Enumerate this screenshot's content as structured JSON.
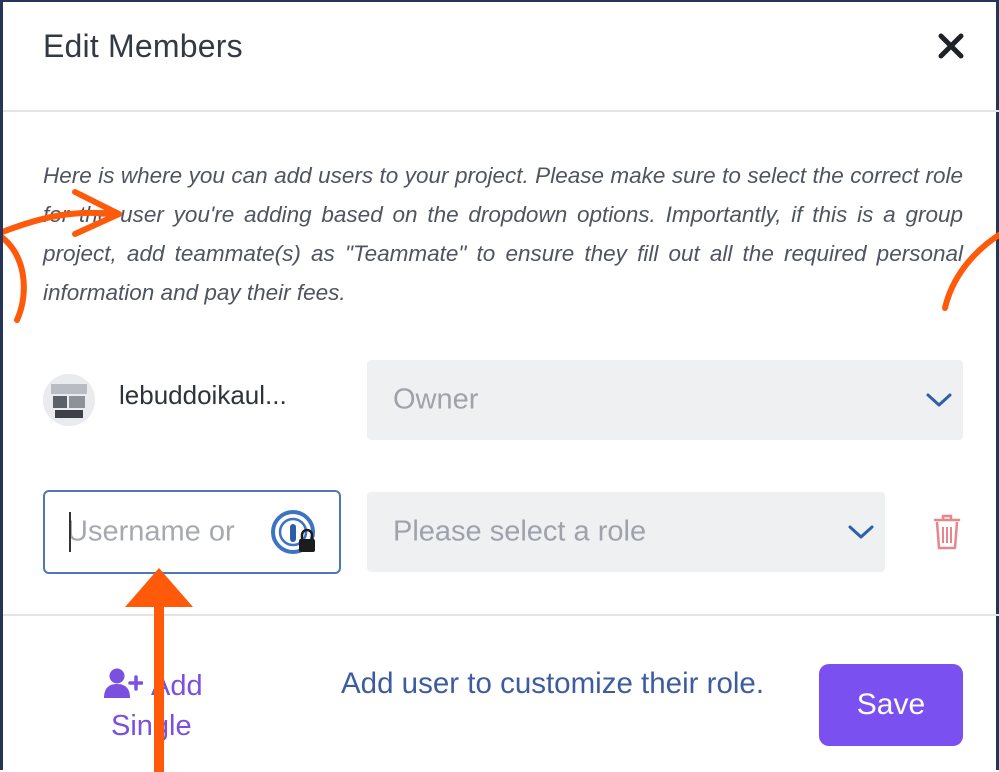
{
  "modal": {
    "title": "Edit Members",
    "intro_text": "Here is where you can add users to your project. Please make sure to select the correct role for the user you're adding based on the dropdown options. Importantly, if this is a group project, add teammate(s) as \"Teammate\" to ensure they fill out all the required personal information and pay their fees."
  },
  "members": {
    "existing": {
      "username": "lebuddoikaul...",
      "role": "Owner"
    },
    "new": {
      "username_placeholder": "Username or",
      "role_placeholder": "Please select a role"
    }
  },
  "footer": {
    "add_single_line1": "Add",
    "add_single_line2": "Single",
    "hint": "Add user to customize their role.",
    "save_label": "Save"
  },
  "icons": {
    "close": "close-icon",
    "chevron": "chevron-down-icon",
    "trash": "trash-icon",
    "user_plus": "user-plus-icon",
    "password_manager": "password-manager-icon"
  },
  "colors": {
    "accent": "#7a50f0",
    "link": "#3d5ca0",
    "focus_border": "#4e77b8",
    "danger": "#e8868a",
    "annotation": "#ff5a0a"
  }
}
